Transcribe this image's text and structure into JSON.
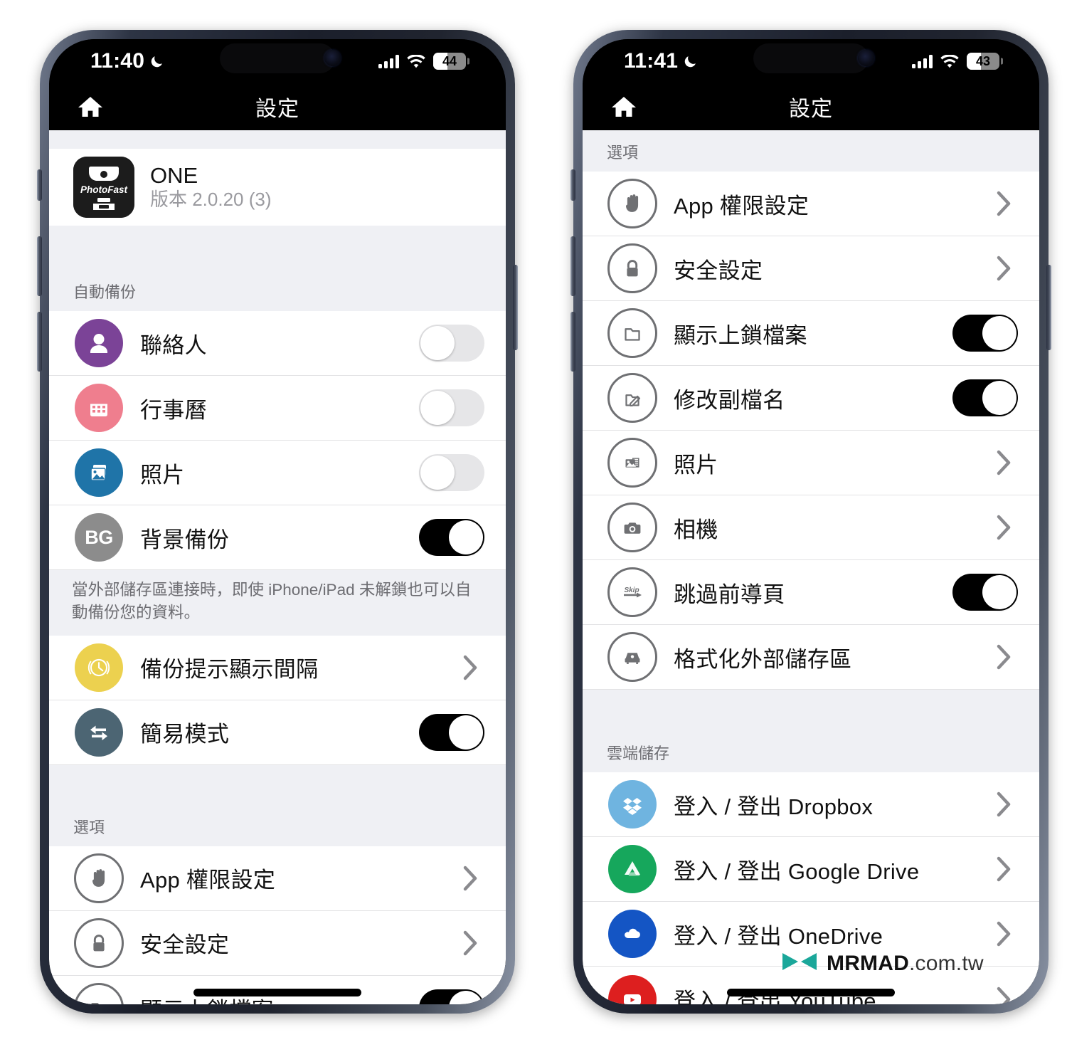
{
  "watermark": {
    "brand": "MRMAD",
    "suffix": ".com.tw",
    "logo_color": "#1aa79a"
  },
  "phones": [
    {
      "id": "left",
      "status": {
        "time": "11:40",
        "moon_icon": "crescent-moon-icon",
        "signal_icon": "cellular-bars-icon",
        "wifi_icon": "wifi-icon",
        "battery_percent": "44",
        "battery_level": 44
      },
      "nav": {
        "home_icon": "home-icon",
        "title": "設定"
      },
      "app": {
        "icon": "photofast-app-icon",
        "icon_label": "PhotoFast",
        "name": "ONE",
        "version": "版本 2.0.20 (3)"
      },
      "sections": [
        {
          "header": "自動備份",
          "rows": [
            {
              "icon": "contacts-icon",
              "icon_style": "filled",
              "color": "#7b4397",
              "label": "聯絡人",
              "control": "toggle",
              "value": "off"
            },
            {
              "icon": "calendar-icon",
              "icon_style": "filled",
              "color": "#ef7e8e",
              "label": "行事曆",
              "control": "toggle",
              "value": "off"
            },
            {
              "icon": "photos-icon",
              "icon_style": "filled",
              "color": "#1f74a8",
              "label": "照片",
              "control": "toggle",
              "value": "off"
            },
            {
              "icon": "background-backup-icon",
              "icon_style": "filled",
              "color": "#8c8c8c",
              "label": "背景備份",
              "control": "toggle",
              "value": "on",
              "badge_text": "BG"
            }
          ],
          "note": "當外部儲存區連接時，即使 iPhone/iPad 未解鎖也可以自動備份您的資料。",
          "rows_after_note": [
            {
              "icon": "clock-icon",
              "icon_style": "filled",
              "color": "#ecd14f",
              "label": "備份提示顯示間隔",
              "control": "chevron"
            },
            {
              "icon": "easy-mode-icon",
              "icon_style": "filled",
              "color": "#4c6573",
              "label": "簡易模式",
              "control": "toggle",
              "value": "on"
            }
          ]
        },
        {
          "header": "選項",
          "rows": [
            {
              "icon": "hand-icon",
              "icon_style": "outline",
              "label": "App 權限設定",
              "control": "chevron"
            },
            {
              "icon": "lock-icon",
              "icon_style": "outline",
              "label": "安全設定",
              "control": "chevron"
            },
            {
              "icon": "folder-icon",
              "icon_style": "outline",
              "label": "顯示上鎖檔案",
              "control": "toggle",
              "value": "on"
            }
          ]
        }
      ]
    },
    {
      "id": "right",
      "status": {
        "time": "11:41",
        "moon_icon": "crescent-moon-icon",
        "signal_icon": "cellular-bars-icon",
        "wifi_icon": "wifi-icon",
        "battery_percent": "43",
        "battery_level": 43
      },
      "nav": {
        "home_icon": "home-icon",
        "title": "設定"
      },
      "sections": [
        {
          "header": "選項",
          "rows": [
            {
              "icon": "hand-icon",
              "icon_style": "outline",
              "label": "App 權限設定",
              "control": "chevron"
            },
            {
              "icon": "lock-icon",
              "icon_style": "outline",
              "label": "安全設定",
              "control": "chevron"
            },
            {
              "icon": "folder-icon",
              "icon_style": "outline",
              "label": "顯示上鎖檔案",
              "control": "toggle",
              "value": "on"
            },
            {
              "icon": "edit-folder-icon",
              "icon_style": "outline",
              "label": "修改副檔名",
              "control": "toggle",
              "value": "on"
            },
            {
              "icon": "photos-stack-icon",
              "icon_style": "outline",
              "label": "照片",
              "control": "chevron"
            },
            {
              "icon": "camera-icon",
              "icon_style": "outline",
              "label": "相機",
              "control": "chevron"
            },
            {
              "icon": "skip-icon",
              "icon_style": "outline",
              "label": "跳過前導頁",
              "control": "toggle",
              "value": "on",
              "badge_text": "Skip"
            },
            {
              "icon": "external-drive-icon",
              "icon_style": "outline",
              "label": "格式化外部儲存區",
              "control": "chevron"
            }
          ]
        },
        {
          "header": "雲端儲存",
          "rows": [
            {
              "icon": "dropbox-icon",
              "icon_style": "filled",
              "color": "#6fb4e0",
              "label": "登入 / 登出 Dropbox",
              "control": "chevron"
            },
            {
              "icon": "google-drive-icon",
              "icon_style": "filled",
              "color": "#16a75c",
              "label": "登入 / 登出 Google Drive",
              "control": "chevron"
            },
            {
              "icon": "onedrive-icon",
              "icon_style": "filled",
              "color": "#1455c4",
              "label": "登入 / 登出 OneDrive",
              "control": "chevron"
            },
            {
              "icon": "youtube-icon",
              "icon_style": "filled",
              "color": "#dd1f1f",
              "label": "登入 / 登出 YouTube",
              "control": "chevron"
            }
          ]
        }
      ]
    }
  ]
}
